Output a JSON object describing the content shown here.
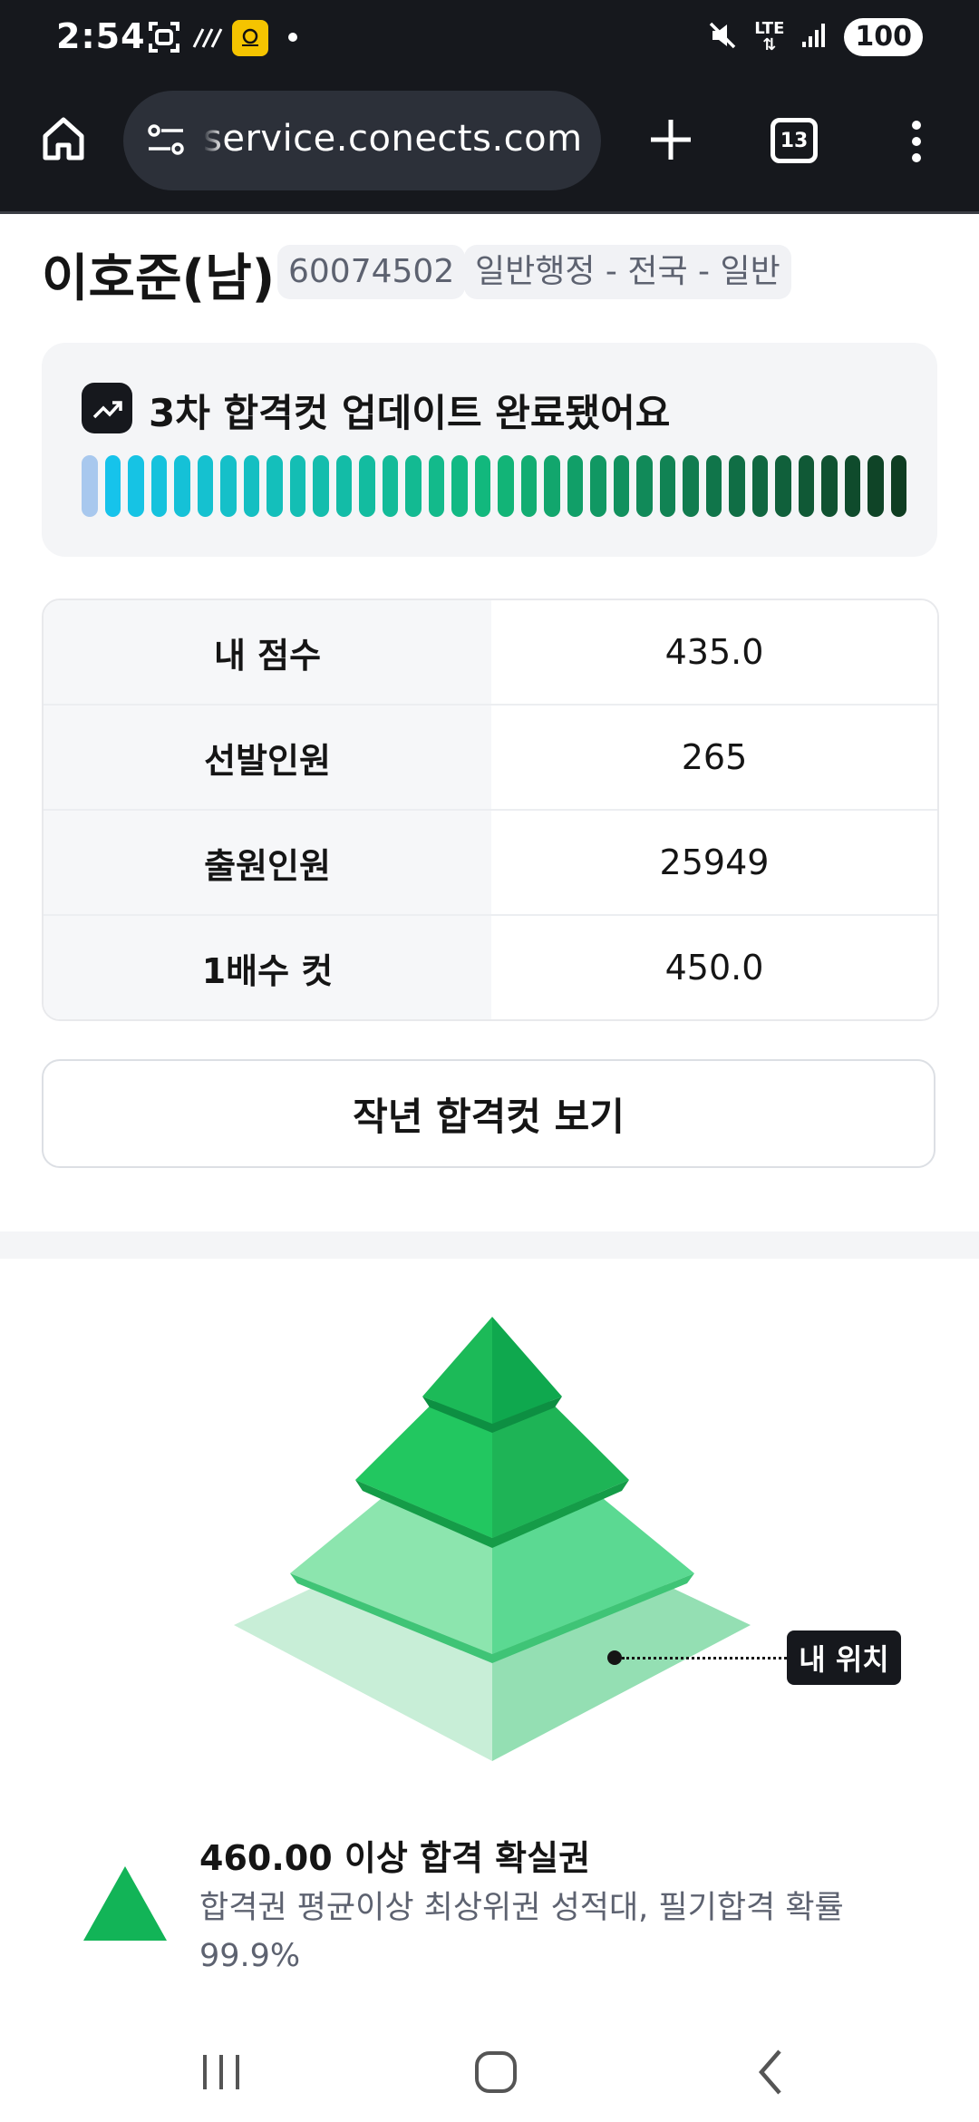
{
  "status_bar": {
    "time": "2:54",
    "network": "LTE",
    "battery": "100"
  },
  "browser": {
    "url": "service.conects.com",
    "tab_count": "13"
  },
  "profile": {
    "name": "이호준(남)",
    "exam_id": "60074502",
    "category": "일반행정 - 전국 - 일반"
  },
  "update_banner": {
    "title": "3차 합격컷 업데이트 완료됐어요",
    "bar_count": 36,
    "gradient_colors": [
      "#16c4f2",
      "#12b87a",
      "#0f3d22"
    ]
  },
  "score_table": {
    "rows": [
      {
        "label": "내 점수",
        "value": "435.0"
      },
      {
        "label": "선발인원",
        "value": "265"
      },
      {
        "label": "출원인원",
        "value": "25949"
      },
      {
        "label": "1배수 컷",
        "value": "450.0"
      }
    ]
  },
  "prev_cut_button": "작년 합격컷 보기",
  "pyramid": {
    "my_position_label": "내 위치",
    "colors": [
      "#0fa84e",
      "#22c760",
      "#8ce5ae",
      "#c8eed7"
    ]
  },
  "tier": {
    "title": "460.00 이상 합격 확실권",
    "description": "합격권 평균이상 최상위권 성적대, 필기합격 확률 99.9%",
    "icon_color": "#12b457"
  }
}
